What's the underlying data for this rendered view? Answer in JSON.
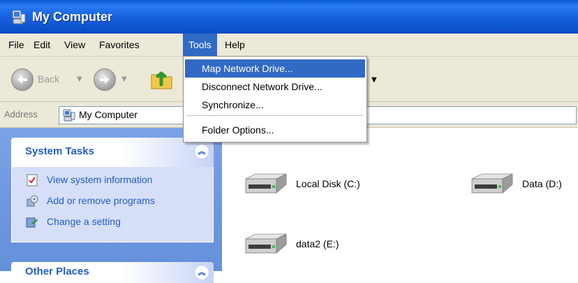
{
  "window": {
    "title": "My Computer",
    "icon": "my-computer-icon"
  },
  "menubar": {
    "items": [
      {
        "label": "File"
      },
      {
        "label": "Edit"
      },
      {
        "label": "View"
      },
      {
        "label": "Favorites"
      },
      {
        "label": "Tools",
        "active": true
      },
      {
        "label": "Help"
      }
    ]
  },
  "toolbar": {
    "back_label": "Back",
    "back_icon": "back-arrow-icon",
    "forward_icon": "forward-arrow-icon",
    "up_icon": "up-folder-icon"
  },
  "address": {
    "label": "Address",
    "value": "My Computer",
    "icon": "my-computer-icon"
  },
  "tools_menu": {
    "items": [
      {
        "label": "Map Network Drive...",
        "highlighted": true
      },
      {
        "label": "Disconnect Network Drive..."
      },
      {
        "label": "Synchronize..."
      },
      {
        "label": "Folder Options..."
      }
    ]
  },
  "tasks": {
    "system_title": "System Tasks",
    "system_items": [
      {
        "label": "View system information",
        "icon": "system-info-icon"
      },
      {
        "label": "Add or remove programs",
        "icon": "add-remove-programs-icon"
      },
      {
        "label": "Change a setting",
        "icon": "control-panel-icon"
      }
    ],
    "other_title": "Other Places"
  },
  "drives": [
    {
      "label": "Local Disk (C:)",
      "icon": "hard-drive-icon"
    },
    {
      "label": "Data (D:)",
      "icon": "hard-drive-icon"
    },
    {
      "label": "data2 (E:)",
      "icon": "hard-drive-icon"
    }
  ],
  "colors": {
    "titlebar": "#0b4cc4",
    "menu_highlight": "#316ac5",
    "task_link": "#215dc6",
    "task_pane": "#6d96e0"
  }
}
